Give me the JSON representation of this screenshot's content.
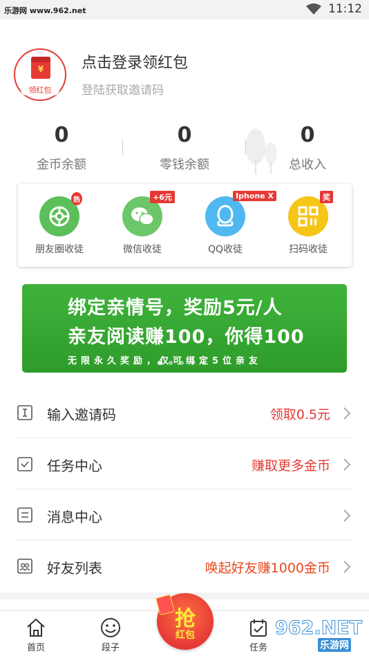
{
  "status_bar": {
    "site_watermark": "乐游网 www.962.net",
    "time": "11:12"
  },
  "profile": {
    "avatar_label": "领红包",
    "avatar_symbol": "¥",
    "title": "点击登录领红包",
    "subtitle": "登陆获取邀请码"
  },
  "stats": [
    {
      "value": "0",
      "label": "金币余额"
    },
    {
      "value": "0",
      "label": "零钱余额"
    },
    {
      "value": "0",
      "label": "总收入"
    }
  ],
  "share_items": [
    {
      "label": "朋友圈收徒",
      "badge": "热",
      "icon": "moments-icon",
      "color": "#5cbf5a"
    },
    {
      "label": "微信收徒",
      "badge": "+6元",
      "icon": "wechat-icon",
      "color": "#6cc66a"
    },
    {
      "label": "QQ收徒",
      "badge": "Iphone X",
      "icon": "qq-icon",
      "color": "#4fb8f0"
    },
    {
      "label": "扫码收徒",
      "badge": "奖",
      "icon": "qrcode-icon",
      "color": "#f5c518"
    }
  ],
  "banner": {
    "line1": "绑定亲情号，奖励5元/人",
    "line2": "亲友阅读赚100，你得100",
    "line3": "无限永久奖励，仅可绑定5位亲友",
    "slide_count": 5,
    "active_slide": 0
  },
  "menu": [
    {
      "title": "输入邀请码",
      "value": "领取0.5元",
      "value_color": "#e53935",
      "icon": "invite-code-icon"
    },
    {
      "title": "任务中心",
      "value": "赚取更多金币",
      "value_color": "#e53935",
      "icon": "task-icon"
    },
    {
      "title": "消息中心",
      "value": "",
      "value_color": "#e53935",
      "icon": "message-icon"
    },
    {
      "title": "好友列表",
      "value": "唤起好友赚1000金币",
      "value_color": "#e8471a",
      "icon": "friends-icon"
    }
  ],
  "bottom_nav": {
    "home": "首页",
    "jokes": "段子",
    "grab_main": "抢",
    "grab_sub": "红包",
    "tasks": "任务"
  },
  "bottom_watermark": {
    "logo": "962.NET",
    "name": "乐游网"
  },
  "colors": {
    "accent_red": "#e53935",
    "banner_green": "#35a632"
  }
}
